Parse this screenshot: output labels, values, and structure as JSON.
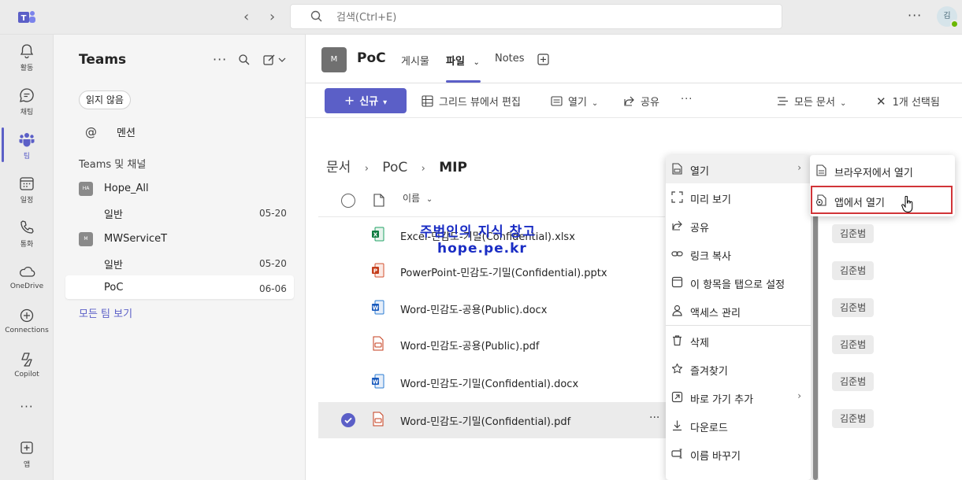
{
  "topbar": {
    "search_placeholder": "검색(Ctrl+E)",
    "nav_back": "‹",
    "nav_forward": "›",
    "more": "···",
    "avatar_initial": "김"
  },
  "rail": {
    "items": [
      {
        "label": "활동",
        "icon": "bell-icon"
      },
      {
        "label": "채팅",
        "icon": "chat-icon"
      },
      {
        "label": "팀",
        "icon": "teams-icon"
      },
      {
        "label": "일정",
        "icon": "calendar-icon"
      },
      {
        "label": "통화",
        "icon": "phone-icon"
      },
      {
        "label": "OneDrive",
        "icon": "cloud-icon"
      },
      {
        "label": "Connections",
        "icon": "connections-icon"
      },
      {
        "label": "Copilot",
        "icon": "copilot-icon"
      },
      {
        "label": "앱",
        "icon": "apps-icon"
      }
    ],
    "more": "···"
  },
  "channels": {
    "title": "Teams",
    "unread_filter": "읽지 않음",
    "mentions": "멘션",
    "section": "Teams 및 채널",
    "teams": [
      {
        "avatar": "HA",
        "name": "Hope_All",
        "channels": [
          {
            "name": "일반",
            "date": "05-20"
          }
        ]
      },
      {
        "avatar": "M",
        "name": "MWServiceT",
        "channels": [
          {
            "name": "일반",
            "date": "05-20"
          },
          {
            "name": "PoC",
            "date": "06-06"
          }
        ]
      }
    ],
    "see_all": "모든 팀 보기"
  },
  "header": {
    "avatar": "M",
    "channel_name": "PoC",
    "tabs": [
      "게시물",
      "파일",
      "Notes"
    ]
  },
  "toolbar": {
    "new": "신규",
    "grid_edit": "그리드 뷰에서 편집",
    "open": "열기",
    "share": "공유",
    "more": "···",
    "all_docs": "모든 문서",
    "selected": "1개 선택됨"
  },
  "breadcrumb": [
    "문서",
    "PoC",
    "MIP"
  ],
  "columns": {
    "name": "이름"
  },
  "files": [
    {
      "name": "Excel-민감도-기밀(Confidential).xlsx",
      "type": "xlsx",
      "owner": "김준범"
    },
    {
      "name": "PowerPoint-민감도-기밀(Confidential).pptx",
      "type": "pptx",
      "owner": "김준범"
    },
    {
      "name": "Word-민감도-공용(Public).docx",
      "type": "docx",
      "owner": "김준범"
    },
    {
      "name": "Word-민감도-공용(Public).pdf",
      "type": "pdf",
      "owner": "김준범"
    },
    {
      "name": "Word-민감도-기밀(Confidential).docx",
      "type": "docx",
      "owner": "김준범"
    },
    {
      "name": "Word-민감도-기밀(Confidential).pdf",
      "type": "pdf",
      "owner": "김준범"
    }
  ],
  "watermark": {
    "line1": "주범인의 지식 창고",
    "line2": "hope.pe.kr"
  },
  "context_menu": [
    {
      "label": "열기",
      "icon": "open-icon",
      "submenu": true
    },
    {
      "label": "미리 보기",
      "icon": "preview-icon"
    },
    {
      "label": "공유",
      "icon": "share-icon"
    },
    {
      "label": "링크 복사",
      "icon": "link-icon"
    },
    {
      "label": "이 항목을 탭으로 설정",
      "icon": "tab-icon"
    },
    {
      "label": "액세스 관리",
      "icon": "access-icon"
    },
    {
      "label": "삭제",
      "icon": "trash-icon"
    },
    {
      "label": "즐겨찾기",
      "icon": "star-icon"
    },
    {
      "label": "바로 가기 추가",
      "icon": "shortcut-icon",
      "submenu": true
    },
    {
      "label": "다운로드",
      "icon": "download-icon"
    },
    {
      "label": "이름 바꾸기",
      "icon": "rename-icon"
    }
  ],
  "submenu": [
    {
      "label": "브라우저에서 열기",
      "icon": "browser-icon"
    },
    {
      "label": "앱에서 열기",
      "icon": "app-icon"
    }
  ],
  "colors": {
    "accent": "#5b5fc7",
    "highlight_box": "#d13438",
    "watermark": "#1a2dc4"
  }
}
